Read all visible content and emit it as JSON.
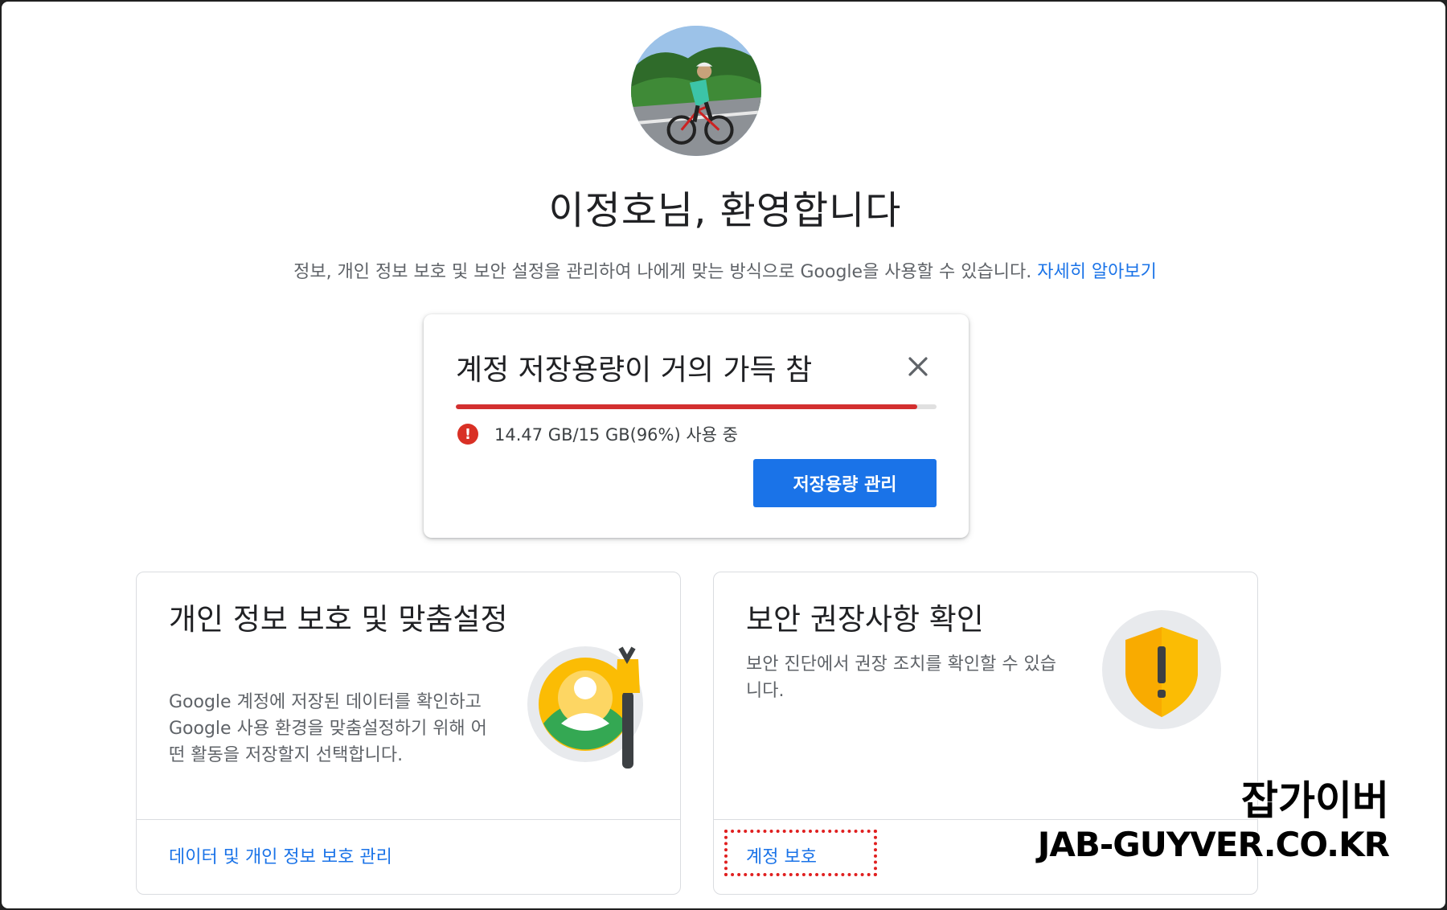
{
  "welcome": "이정호님, 환영합니다",
  "subtitle": {
    "text": "정보, 개인 정보 보호 및 보안 설정을 관리하여 나에게 맞는 방식으로 Google을 사용할 수 있습니다.",
    "link": "자세히 알아보기"
  },
  "storage": {
    "title": "계정 저장용량이 거의 가득 참",
    "usage": "14.47 GB/15 GB(96%) 사용 중",
    "percent": 96,
    "button": "저장용량 관리",
    "colors": {
      "bar": "#d32f2f",
      "button": "#1a73e8",
      "error": "#d93025"
    }
  },
  "privacy_card": {
    "title": "개인 정보 보호 및 맞춤설정",
    "description": "Google 계정에 저장된 데이터를 확인하고 Google 사용 환경을 맞춤설정하기 위해 어떤 활동을 저장할지 선택합니다.",
    "link": "데이터 및 개인 정보 보호 관리",
    "icon": "privacy-personalization-icon"
  },
  "security_card": {
    "title": "보안 권장사항 확인",
    "description": "보안 진단에서 권장 조치를 확인할 수 있습니다.",
    "link": "계정 보호",
    "icon": "security-shield-icon"
  },
  "watermark": {
    "line1": "잡가이버",
    "line2": "JAB-GUYVER.CO.KR"
  }
}
